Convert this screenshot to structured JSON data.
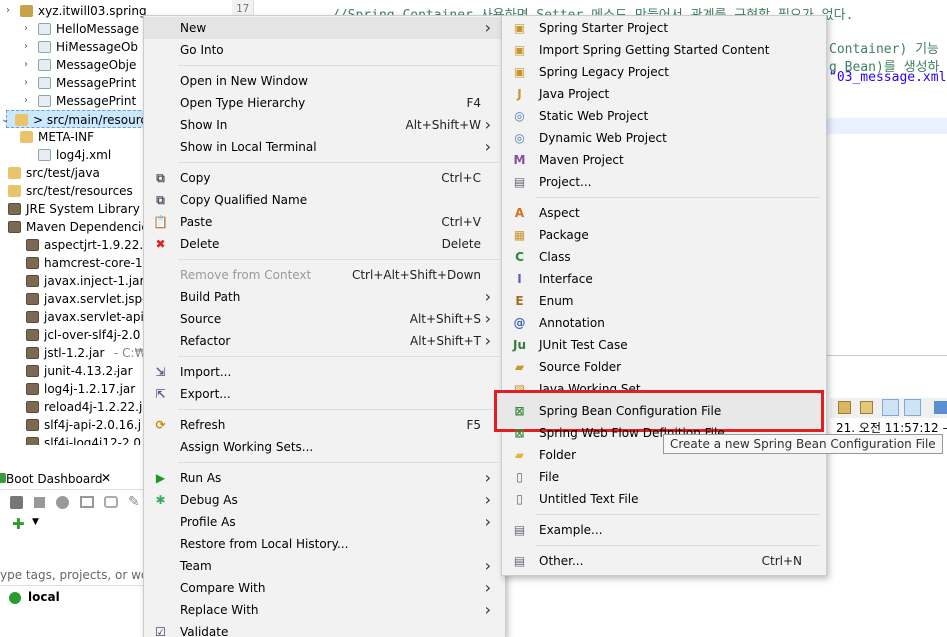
{
  "editor": {
    "line_number": "17",
    "lines": [
      "//Spring Container 사용하면 Setter 메소드 만들어서 관계를 구현할 필요가 없다.",
      "Container) 기능",
      "g Bean)를 생성하",
      "\"03_message.xml"
    ],
    "console_timestamp": "21. 오전 11:57:12 – 5"
  },
  "tree": [
    {
      "label": "xyz.itwill03.spring",
      "type": "pkg"
    },
    {
      "label": "HelloMessage",
      "type": "file"
    },
    {
      "label": "HiMessageOb",
      "type": "file"
    },
    {
      "label": "MessageObje",
      "type": "file"
    },
    {
      "label": "MessagePrint",
      "type": "file"
    },
    {
      "label": "MessagePrint",
      "type": "file"
    },
    {
      "label": "> src/main/resourc",
      "type": "fold"
    },
    {
      "label": "META-INF",
      "type": "fold"
    },
    {
      "label": "log4j.xml",
      "type": "file"
    },
    {
      "label": "src/test/java",
      "type": "fold"
    },
    {
      "label": "src/test/resources",
      "type": "fold"
    },
    {
      "label": "JRE System Library",
      "type": "lib"
    },
    {
      "label": "Maven Dependencie",
      "type": "lib"
    },
    {
      "label": "aspectjrt-1.9.22.",
      "type": "jar"
    },
    {
      "label": "hamcrest-core-1",
      "type": "jar"
    },
    {
      "label": "javax.inject-1.jar",
      "type": "jar"
    },
    {
      "label": "javax.servlet.jsp-",
      "type": "jar"
    },
    {
      "label": "javax.servlet-api-",
      "type": "jar"
    },
    {
      "label": "jcl-over-slf4j-2.0",
      "type": "jar"
    },
    {
      "label": "jstl-1.2.jar",
      "suffix": " - C:₩",
      "type": "jar"
    },
    {
      "label": "junit-4.13.2.jar",
      "suffix": " -",
      "type": "jar"
    },
    {
      "label": "log4j-1.2.17.jar",
      "type": "jar"
    },
    {
      "label": "reload4j-1.2.22.j",
      "type": "jar"
    },
    {
      "label": "slf4j-api-2.0.16.j",
      "type": "jar"
    },
    {
      "label": "slf4j-log4j12-2.0",
      "type": "jar"
    }
  ],
  "boot_dashboard": {
    "title": "Boot Dashboard",
    "close": "✕",
    "filter_placeholder": "ype tags, projects, or worki",
    "local_label": "local"
  },
  "context_menu": [
    {
      "label": "New",
      "submenu": true,
      "icon": ""
    },
    {
      "label": "Go Into"
    },
    {
      "sep": true
    },
    {
      "label": "Open in New Window"
    },
    {
      "label": "Open Type Hierarchy",
      "key": "F4"
    },
    {
      "label": "Show In",
      "key": "Alt+Shift+W",
      "submenu": true
    },
    {
      "label": "Show in Local Terminal",
      "submenu": true
    },
    {
      "sep": true
    },
    {
      "label": "Copy",
      "key": "Ctrl+C",
      "icon": "copy-icon"
    },
    {
      "label": "Copy Qualified Name",
      "icon": "copy-icon"
    },
    {
      "label": "Paste",
      "key": "Ctrl+V",
      "icon": "paste-icon"
    },
    {
      "label": "Delete",
      "key": "Delete",
      "icon": "delete-icon"
    },
    {
      "sep": true
    },
    {
      "label": "Remove from Context",
      "key": "Ctrl+Alt+Shift+Down",
      "disabled": true
    },
    {
      "label": "Build Path",
      "submenu": true
    },
    {
      "label": "Source",
      "key": "Alt+Shift+S",
      "submenu": true
    },
    {
      "label": "Refactor",
      "key": "Alt+Shift+T",
      "submenu": true
    },
    {
      "sep": true
    },
    {
      "label": "Import...",
      "icon": "import-icon"
    },
    {
      "label": "Export...",
      "icon": "export-icon"
    },
    {
      "sep": true
    },
    {
      "label": "Refresh",
      "key": "F5",
      "icon": "refresh-icon"
    },
    {
      "label": "Assign Working Sets..."
    },
    {
      "sep": true
    },
    {
      "label": "Run As",
      "submenu": true,
      "icon": "run-icon"
    },
    {
      "label": "Debug As",
      "submenu": true,
      "icon": "debug-icon"
    },
    {
      "label": "Profile As",
      "submenu": true
    },
    {
      "label": "Restore from Local History..."
    },
    {
      "label": "Team",
      "submenu": true
    },
    {
      "label": "Compare With",
      "submenu": true
    },
    {
      "label": "Replace With",
      "submenu": true
    },
    {
      "label": "Validate",
      "icon": "validate-icon"
    }
  ],
  "new_submenu": [
    {
      "label": "Spring Starter Project",
      "icon": "spring-project-icon"
    },
    {
      "label": "Import Spring Getting Started Content",
      "icon": "spring-project-icon"
    },
    {
      "label": "Spring Legacy Project",
      "icon": "spring-project-icon"
    },
    {
      "label": "Java Project",
      "icon": "java-project-icon"
    },
    {
      "label": "Static Web Project",
      "icon": "web-project-icon"
    },
    {
      "label": "Dynamic Web Project",
      "icon": "web-project-icon"
    },
    {
      "label": "Maven Project",
      "icon": "maven-icon"
    },
    {
      "label": "Project...",
      "icon": "project-icon"
    },
    {
      "sep": true
    },
    {
      "label": "Aspect",
      "icon": "aspect-icon"
    },
    {
      "label": "Package",
      "icon": "package-icon"
    },
    {
      "label": "Class",
      "icon": "class-icon"
    },
    {
      "label": "Interface",
      "icon": "interface-icon"
    },
    {
      "label": "Enum",
      "icon": "enum-icon"
    },
    {
      "label": "Annotation",
      "icon": "annotation-icon"
    },
    {
      "label": "JUnit Test Case",
      "icon": "junit-icon"
    },
    {
      "label": "Source Folder",
      "icon": "source-folder-icon"
    },
    {
      "label": "Java Working Set",
      "icon": "working-set-icon"
    },
    {
      "label": "Spring Bean Configuration File",
      "icon": "spring-bean-icon",
      "highlight": true
    },
    {
      "label": "Spring Web Flow Definition File",
      "icon": "spring-bean-icon"
    },
    {
      "label": "Folder",
      "icon": "folder-icon"
    },
    {
      "label": "File",
      "icon": "file-icon"
    },
    {
      "label": "Untitled Text File",
      "icon": "file-icon"
    },
    {
      "sep": true
    },
    {
      "label": "Example...",
      "icon": "example-icon"
    },
    {
      "sep": true
    },
    {
      "label": "Other...",
      "key": "Ctrl+N",
      "icon": "other-icon"
    }
  ],
  "tooltip": "Create a new Spring Bean Configuration File",
  "colors": {
    "comment": "#3f7f5f",
    "string": "#2a00ff",
    "highlight": "#e02020"
  }
}
